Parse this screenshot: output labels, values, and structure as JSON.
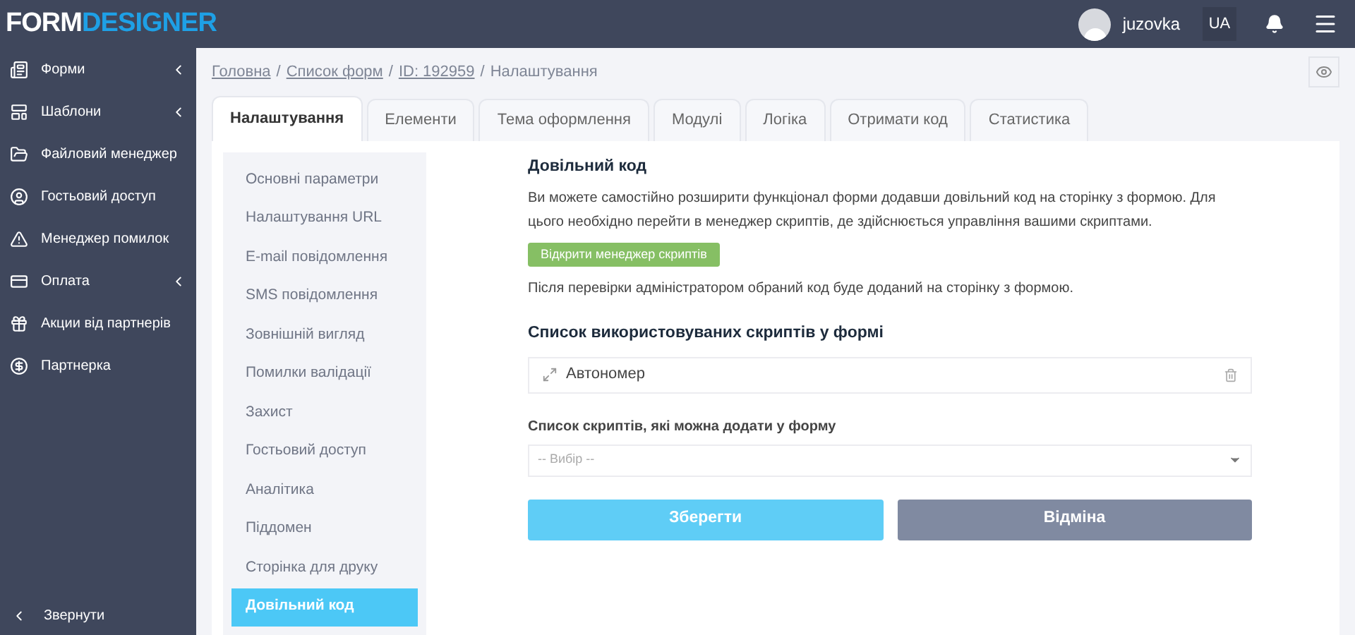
{
  "logo": {
    "part_1": "FORM",
    "part_2": "DESIGNER"
  },
  "user": {
    "name": "juzovka",
    "language": "UA"
  },
  "sidebar": {
    "items": [
      {
        "label": "Форми",
        "submenu": true
      },
      {
        "label": "Шаблони",
        "submenu": true
      },
      {
        "label": "Файловий менеджер",
        "submenu": false
      },
      {
        "label": "Гостьовий доступ",
        "submenu": false
      },
      {
        "label": "Менеджер помилок",
        "submenu": false
      },
      {
        "label": "Оплата",
        "submenu": true
      },
      {
        "label": "Акции від партнерів",
        "submenu": false
      },
      {
        "label": "Партнерка",
        "submenu": false
      }
    ],
    "collapse": "Звернути"
  },
  "breadcrumb": [
    {
      "label": "Головна",
      "link": true,
      "separator": "/"
    },
    {
      "label": "Список форм",
      "link": true,
      "separator": "/"
    },
    {
      "label": "ID: 192959",
      "link": true,
      "separator": "/"
    },
    {
      "label": "Налаштування",
      "link": false
    }
  ],
  "tabs": [
    {
      "label": "Налаштування",
      "selected": true
    },
    {
      "label": "Елементи",
      "selected": false
    },
    {
      "label": "Тема оформлення",
      "selected": false
    },
    {
      "label": "Модулі",
      "selected": false
    },
    {
      "label": "Логіка",
      "selected": false
    },
    {
      "label": "Отримати код",
      "selected": false
    },
    {
      "label": "Статистика",
      "selected": false
    }
  ],
  "settings_menu": [
    {
      "label": "Основні параметри",
      "selected": false
    },
    {
      "label": "Налаштування URL",
      "selected": false
    },
    {
      "label": "E-mail повідомлення",
      "selected": false
    },
    {
      "label": "SMS повідомлення",
      "selected": false
    },
    {
      "label": "Зовнішній вигляд",
      "selected": false
    },
    {
      "label": "Помилки валідації",
      "selected": false
    },
    {
      "label": "Захист",
      "selected": false
    },
    {
      "label": "Гостьовий доступ",
      "selected": false
    },
    {
      "label": "Аналітика",
      "selected": false
    },
    {
      "label": "Піддомен",
      "selected": false
    },
    {
      "label": "Сторінка для друку",
      "selected": false
    },
    {
      "label": "Довільний код",
      "selected": true
    }
  ],
  "content": {
    "title": "Довільний код",
    "description": "Ви можете самостійно розширити функціонал форми додавши довільний код на сторінку з формою. Для цього необхідно перейти в менеджер скриптів, де здійснюється управління вашими скриптами.",
    "open_manager_button": "Відкрити менеджер скриптів",
    "note": "Після перевірки адміністратором обраний код буде доданий на сторінку з формою.",
    "used_scripts_title": "Список використовуваних скриптів у формі",
    "used_scripts": [
      {
        "name": "Автономер"
      }
    ],
    "available_label": "Список скриптів, які можна додати у форму",
    "available_placeholder": "-- Вибір --",
    "save_button": "Зберегти",
    "cancel_button": "Відміна"
  }
}
